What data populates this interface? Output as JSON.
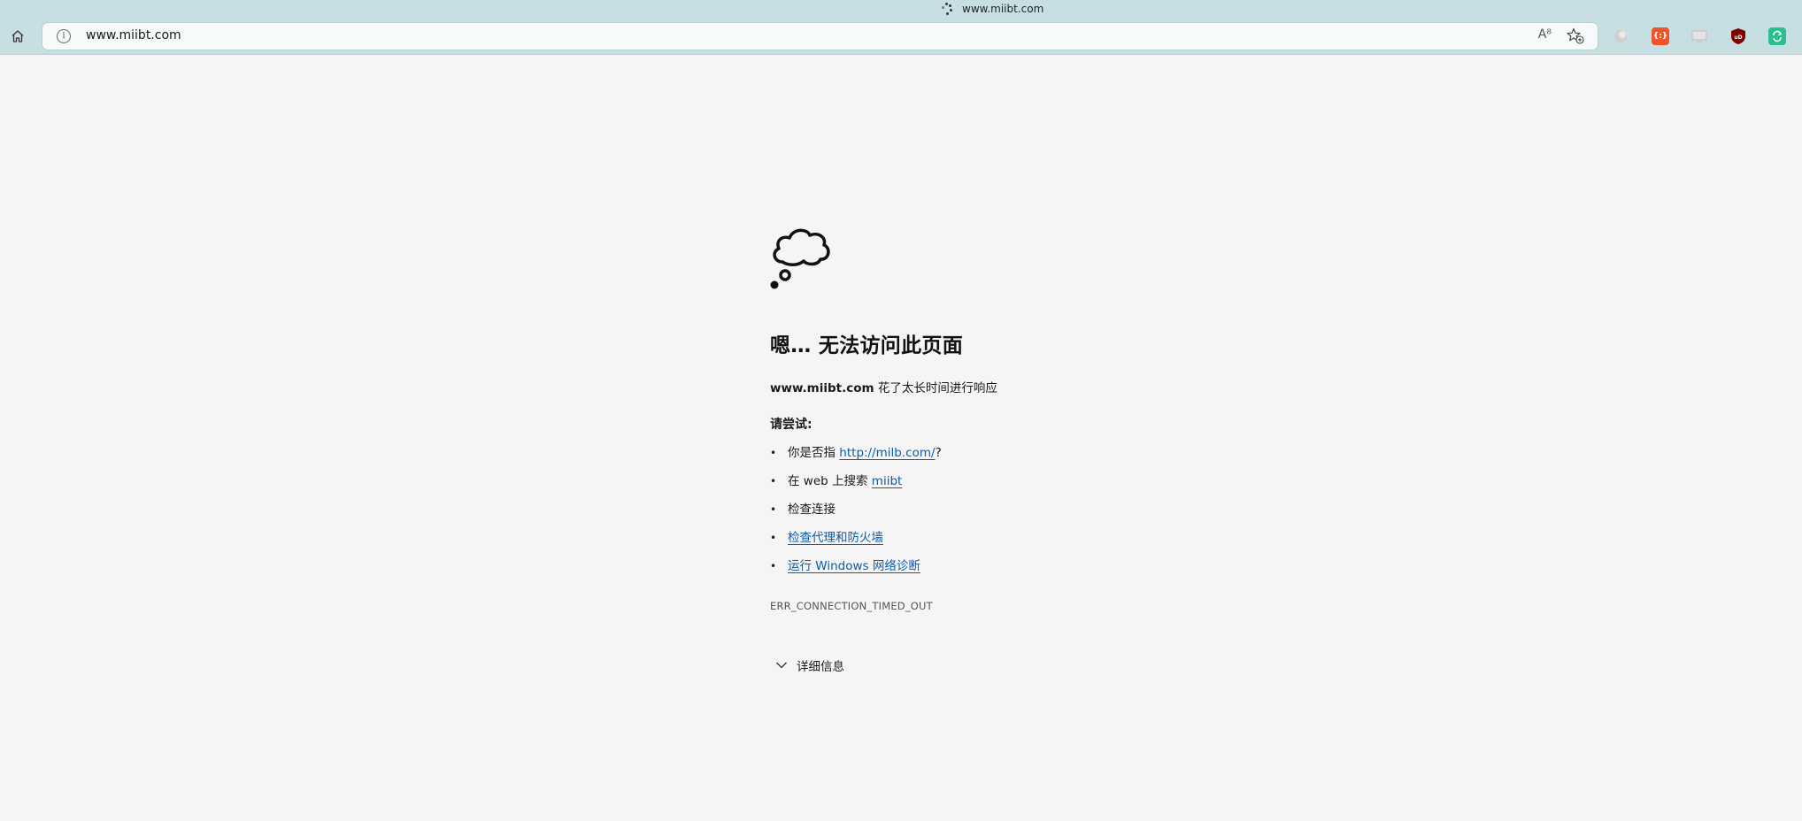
{
  "tab": {
    "title": "www.miibt.com"
  },
  "addressbar": {
    "url": "www.miibt.com"
  },
  "toolbar": {
    "home_icon": "home-icon",
    "info_icon": "info-icon",
    "read_aloud_icon": "read-aloud-icon",
    "read_aloud_label": "A⁸",
    "favorite_icon": "add-favorite-icon",
    "extensions": [
      {
        "name": "grey-circle-extension",
        "color": "#c8c8c8"
      },
      {
        "name": "json-extension",
        "color": "#f0542a",
        "label": "{:}"
      },
      {
        "name": "screen-extension",
        "color": "#d8d8d8"
      },
      {
        "name": "ublock-extension",
        "color": "#800000",
        "label": "uD"
      },
      {
        "name": "sync-extension",
        "color": "#2bbf8f"
      }
    ]
  },
  "error": {
    "icon": "thought-cloud-icon",
    "heading": "嗯… 无法访问此页面",
    "host": "www.miibt.com",
    "message": " 花了太长时间进行响应",
    "try_label": "请尝试:",
    "suggestions": {
      "s1_prefix": "你是否指 ",
      "s1_link": "http://milb.com/",
      "s1_suffix": "?",
      "s2_prefix": "在 web 上搜索 ",
      "s2_link": "miibt",
      "s3": "检查连接",
      "s4_link": "检查代理和防火墙",
      "s5_link": "运行 Windows 网络诊断"
    },
    "code": "ERR_CONNECTION_TIMED_OUT",
    "details_label": "详细信息",
    "details_icon": "chevron-down-icon"
  }
}
